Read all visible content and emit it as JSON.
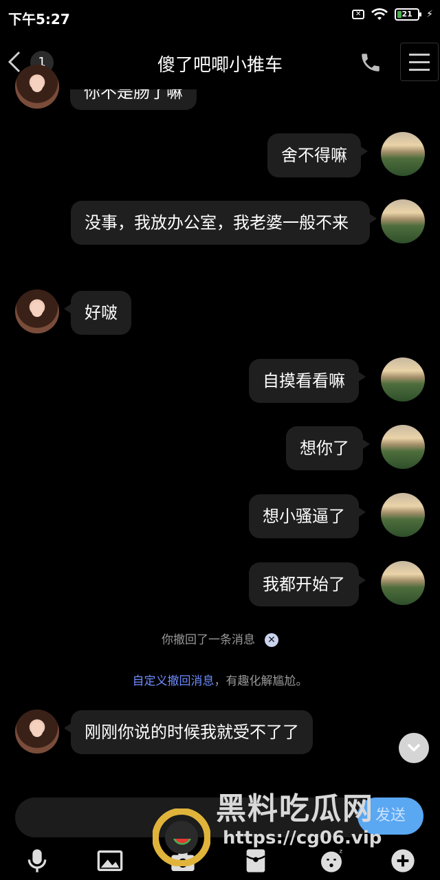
{
  "status_bar": {
    "time": "下午5:27",
    "battery": "21"
  },
  "nav": {
    "unread_count": "1",
    "title": "傻了吧唧小推车"
  },
  "messages": [
    {
      "side": "left",
      "text": "你不是肠了嘛"
    },
    {
      "side": "right",
      "text": "舍不得嘛"
    },
    {
      "side": "right",
      "text": "没事，我放办公室，我老婆一般不来"
    },
    {
      "side": "left",
      "text": "好啵"
    },
    {
      "side": "right",
      "text": "自摸看看嘛"
    },
    {
      "side": "right",
      "text": "想你了"
    },
    {
      "side": "right",
      "text": "想小骚逼了"
    },
    {
      "side": "right",
      "text": "我都开始了"
    },
    {
      "side": "left",
      "text": "刚刚你说的时候我就受不了了"
    }
  ],
  "system": {
    "recall_notice": "你撤回了一条消息",
    "custom_recall_link": "自定义撤回消息",
    "custom_recall_suffix": "，有趣化解尴尬。"
  },
  "composer": {
    "send_label": "发送"
  },
  "watermark": {
    "name": "黑料吃瓜网",
    "url": "https://cg06.vip"
  },
  "icons": {
    "back": "chevron-left-icon",
    "phone": "phone-icon",
    "menu": "menu-icon",
    "mic": "microphone-icon",
    "image": "image-icon",
    "camera": "camera-icon",
    "redpacket": "red-packet-icon",
    "emoji": "emoji-icon",
    "plus": "plus-icon"
  }
}
